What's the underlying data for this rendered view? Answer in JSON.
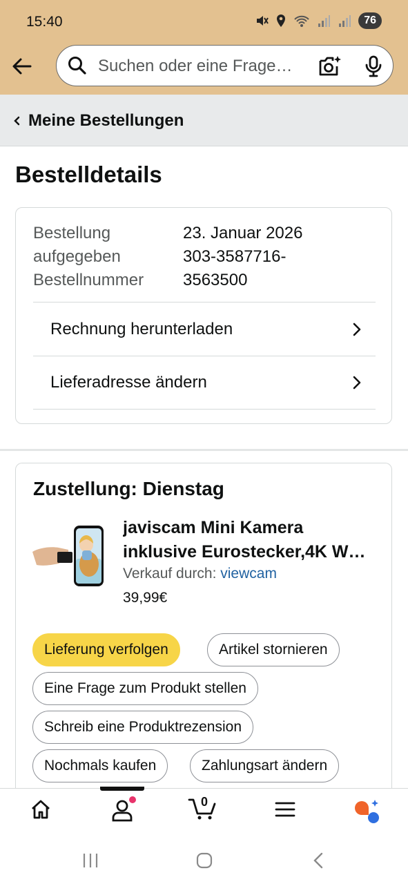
{
  "status_bar": {
    "time": "15:40",
    "battery": "76"
  },
  "search": {
    "placeholder": "Suchen oder eine Frage…"
  },
  "breadcrumb": {
    "label": "Meine Bestellungen"
  },
  "page": {
    "title": "Bestelldetails"
  },
  "order_info": {
    "labels": [
      "Bestellung",
      "aufgegeben",
      "Bestellnummer"
    ],
    "values": [
      "23. Januar 2026",
      "303-3587716-",
      "3563500"
    ]
  },
  "actions": {
    "invoice": "Rechnung herunterladen",
    "address": "Lieferadresse ändern"
  },
  "delivery": {
    "title": "Zustellung: Dienstag",
    "product_title_line1": "javiscam Mini Kamera",
    "product_title_line2": "inklusive Eurostecker,4K W…",
    "seller_prefix": "Verkauf durch:",
    "seller_name": "viewcam",
    "price": "39,99€"
  },
  "buttons": {
    "track": "Lieferung verfolgen",
    "cancel": "Artikel stornieren",
    "question": "Eine Frage zum Produkt stellen",
    "review": "Schreib eine Produktrezension",
    "buy_again": "Nochmals kaufen",
    "payment": "Zahlungsart ändern"
  },
  "bottom_nav": {
    "cart_count": "0"
  },
  "colors": {
    "header": "#e3c190",
    "primary_button": "#f7d548",
    "link": "#2162a1"
  }
}
